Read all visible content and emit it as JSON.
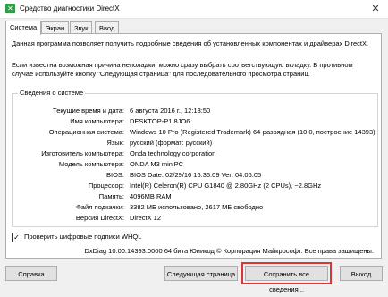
{
  "window": {
    "title": "Средство диагностики DirectX",
    "close_glyph": "✕",
    "icon_glyph": "✕"
  },
  "tabs": [
    {
      "label": "Система",
      "active": true
    },
    {
      "label": "Экран",
      "active": false
    },
    {
      "label": "Звук",
      "active": false
    },
    {
      "label": "Ввод",
      "active": false
    }
  ],
  "intro": "Данная программа позволяет получить подробные сведения об установленных компонентах и драйверах DirectX.",
  "hint": "Если известна возможная причина неполадки, можно сразу выбрать соответствующую вкладку. В противном случае используйте кнопку \"Следующая страница\" для последовательного просмотра страниц.",
  "system_info": {
    "group_title": "Сведения о системе",
    "rows": [
      {
        "label": "Текущие время и дата:",
        "value": "6 августа 2016 г., 12:13:50"
      },
      {
        "label": "Имя компьютера:",
        "value": "DESKTOP-P1I8JO6"
      },
      {
        "label": "Операционная система:",
        "value": "Windows 10 Pro (Registered Trademark) 64-разрядная (10.0, построение 14393)"
      },
      {
        "label": "Язык:",
        "value": "русский (формат: русский)"
      },
      {
        "label": "Изготовитель компьютера:",
        "value": "Onda technology corporation"
      },
      {
        "label": "Модель компьютера:",
        "value": "ONDA M3 miniPC"
      },
      {
        "label": "BIOS:",
        "value": "BIOS Date: 02/29/16 16:36:09 Ver: 04.06.05"
      },
      {
        "label": "Процессор:",
        "value": "Intel(R) Celeron(R) CPU G1840 @ 2.80GHz (2 CPUs), ~2.8GHz"
      },
      {
        "label": "Память:",
        "value": "4096MB RAM"
      },
      {
        "label": "Файл подкачки:",
        "value": "3382 МБ использовано, 2617 МБ свободно"
      },
      {
        "label": "Версия DirectX:",
        "value": "DirectX 12"
      }
    ]
  },
  "whql": {
    "label": "Проверить цифровые подписи WHQL",
    "checked": true,
    "check_glyph": "✓"
  },
  "copyright": "DxDiag 10.00.14393.0000 64 бита Юникод © Корпорация Майкрософт. Все права защищены.",
  "buttons": {
    "help": "Справка",
    "next": "Следующая страница",
    "save": "Сохранить все сведения...",
    "exit": "Выход"
  },
  "colors": {
    "highlight": "#d93636",
    "app_icon": "#2f9e44"
  }
}
